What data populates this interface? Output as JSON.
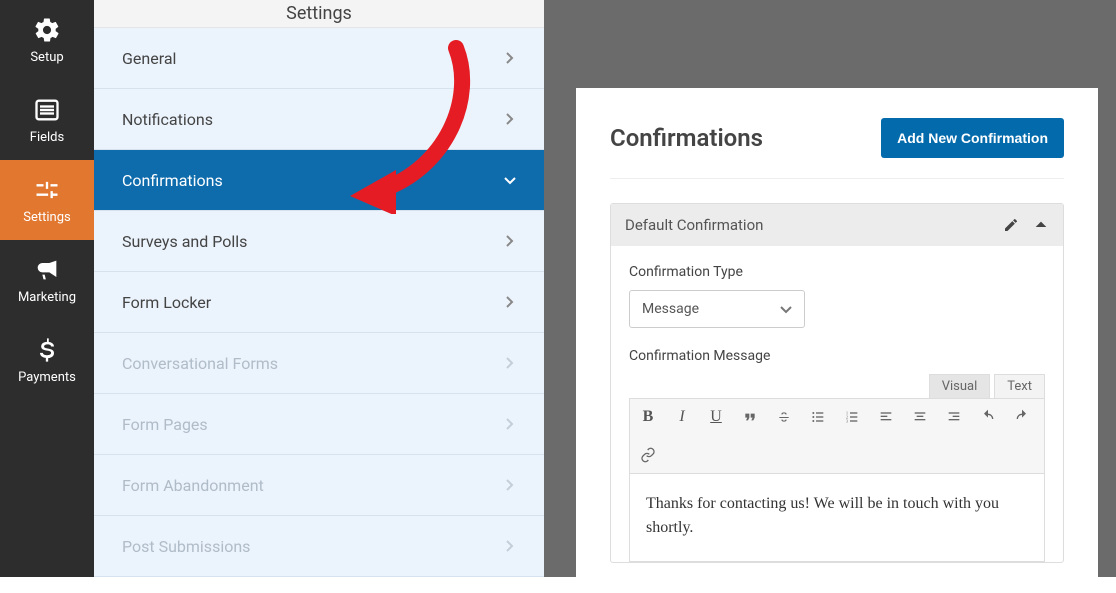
{
  "sidebar": {
    "items": [
      {
        "label": "Setup",
        "icon": "gear-icon"
      },
      {
        "label": "Fields",
        "icon": "list-icon"
      },
      {
        "label": "Settings",
        "icon": "sliders-icon",
        "active": true
      },
      {
        "label": "Marketing",
        "icon": "bullhorn-icon"
      },
      {
        "label": "Payments",
        "icon": "dollar-icon"
      }
    ]
  },
  "center": {
    "title": "Settings",
    "rows": [
      {
        "label": "General",
        "state": "normal"
      },
      {
        "label": "Notifications",
        "state": "normal"
      },
      {
        "label": "Confirmations",
        "state": "active"
      },
      {
        "label": "Surveys and Polls",
        "state": "normal"
      },
      {
        "label": "Form Locker",
        "state": "normal"
      },
      {
        "label": "Conversational Forms",
        "state": "disabled"
      },
      {
        "label": "Form Pages",
        "state": "disabled"
      },
      {
        "label": "Form Abandonment",
        "state": "disabled"
      },
      {
        "label": "Post Submissions",
        "state": "disabled"
      }
    ]
  },
  "panel": {
    "title": "Confirmations",
    "addButton": "Add New Confirmation",
    "confirmation": {
      "header": "Default Confirmation",
      "typeLabel": "Confirmation Type",
      "typeValue": "Message",
      "messageLabel": "Confirmation Message",
      "tabs": {
        "visual": "Visual",
        "text": "Text"
      },
      "message": "Thanks for contacting us! We will be in touch with you shortly."
    }
  }
}
